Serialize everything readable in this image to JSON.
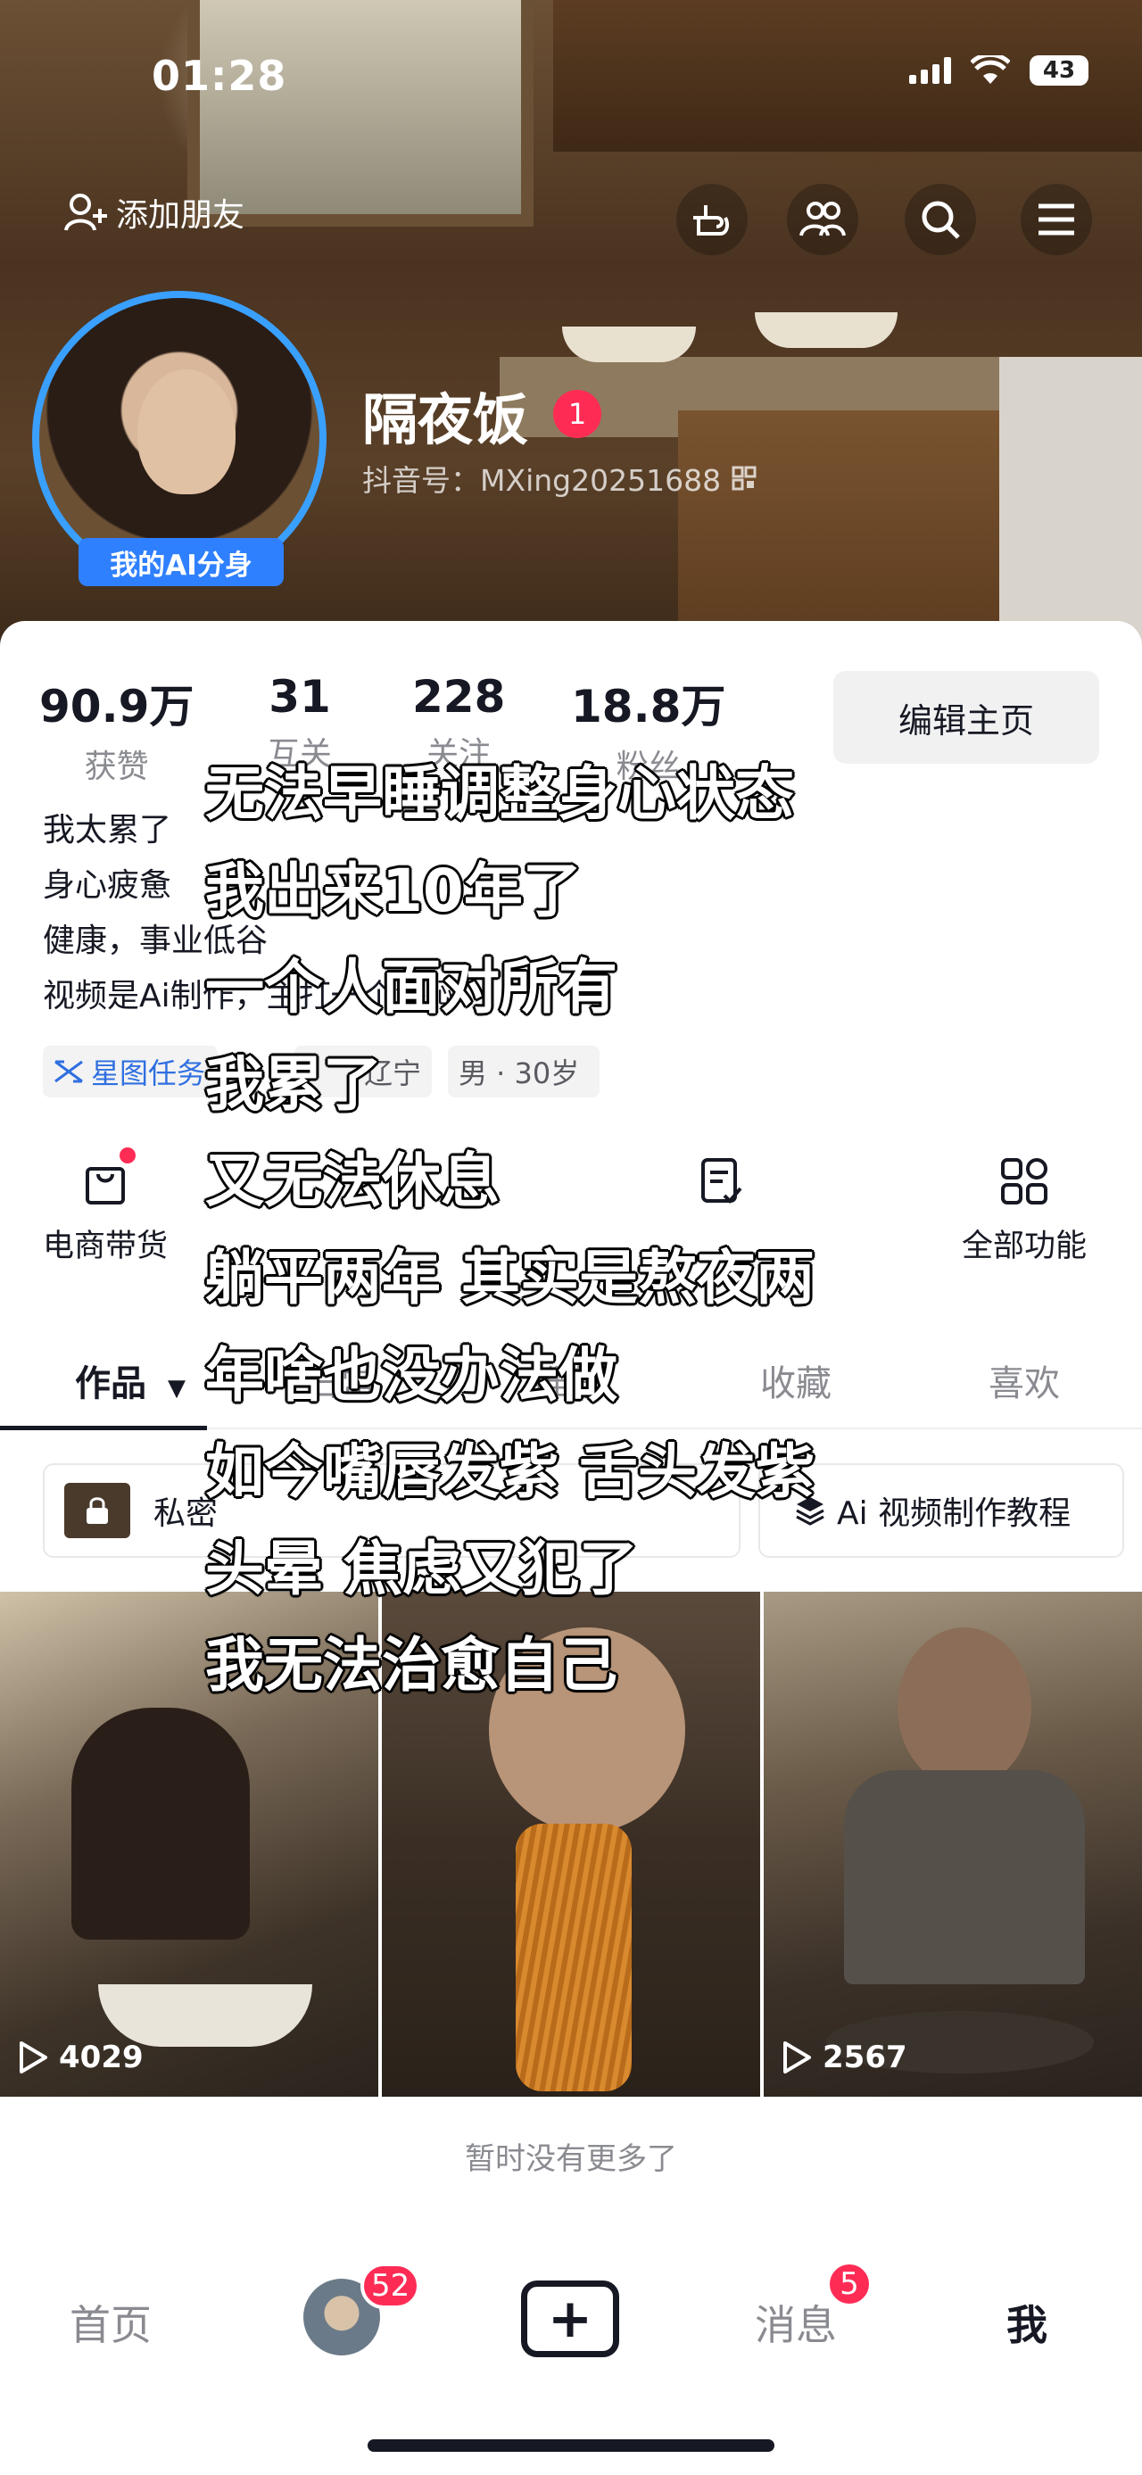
{
  "status": {
    "time": "01:28",
    "battery": "43"
  },
  "header": {
    "add_friend": "添加朋友"
  },
  "profile": {
    "ai_badge": "我的AI分身",
    "nickname": "隔夜饭",
    "badge": "1",
    "douyin_id": "抖音号：MXing20251688"
  },
  "stats": [
    {
      "num": "90.9万",
      "label": "获赞"
    },
    {
      "num": "31",
      "label": "互关"
    },
    {
      "num": "228",
      "label": "关注"
    },
    {
      "num": "18.8万",
      "label": "粉丝"
    }
  ],
  "edit_button": "编辑主页",
  "bio": [
    "我太累了",
    "身心疲惫",
    "健康，事业低谷",
    "视频是Ai制作，主打一个解闷"
  ],
  "tags": {
    "star": "星图任务",
    "location": "辽宁",
    "gender_age": "男 · 30岁"
  },
  "functions": {
    "shop": "电商带货",
    "all": "全部功能"
  },
  "tabs": {
    "works": "作品",
    "daily": "日常",
    "recommend": "推荐",
    "favorites": "收藏",
    "likes": "喜欢"
  },
  "pills": {
    "private": "私密",
    "tutorial": "Ai 视频制作教程"
  },
  "videos": [
    {
      "plays": "4029"
    },
    {
      "plays": ""
    },
    {
      "plays": "2567"
    }
  ],
  "no_more": "暂时没有更多了",
  "bottom_nav": {
    "home": "首页",
    "friends_count": "52",
    "messages": "消息",
    "messages_count": "5",
    "me": "我"
  },
  "overlay_lines": [
    "无法早睡调整身心状态",
    "我出来10年了",
    "一个人面对所有",
    "我累了",
    "又无法休息",
    "躺平两年 其实是熬夜两",
    "年啥也没办法做",
    "如今嘴唇发紫 舌头发紫",
    "头晕 焦虑又犯了",
    "我无法治愈自己"
  ],
  "colors": {
    "accent": "#fe2c55",
    "ai_badge": "#2f80ff",
    "text": "#161823",
    "muted": "#8a8b91"
  }
}
